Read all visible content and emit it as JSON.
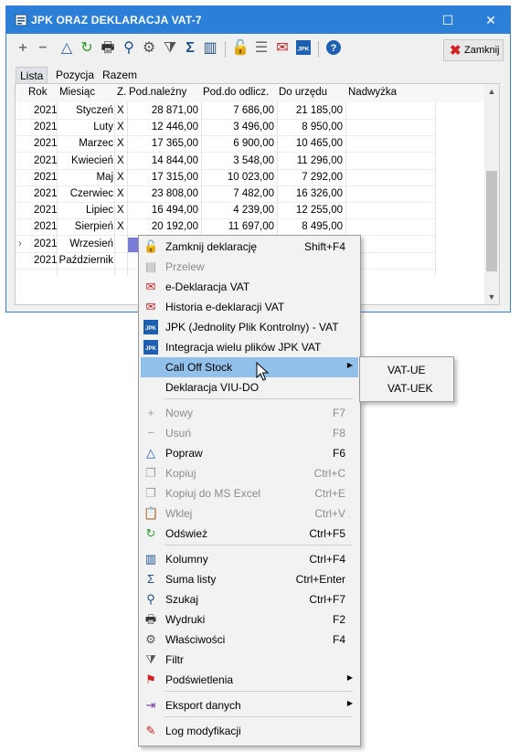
{
  "window": {
    "title": "JPK ORAZ DEKLARACJA VAT-7",
    "close_label": "Zamknij"
  },
  "tabs": [
    "Lista",
    "Pozycja",
    "Razem"
  ],
  "columns": [
    "Rok",
    "Miesiąc",
    "Z.",
    "Pod.należny",
    "Pod.do odlicz.",
    "Do urzędu",
    "Nadwyżka"
  ],
  "rows": [
    {
      "rok": "2021",
      "miesiac": "Styczeń",
      "z": "X",
      "nalezny": "28 871,00",
      "odlicz": "7 686,00",
      "urzad": "21 185,00"
    },
    {
      "rok": "2021",
      "miesiac": "Luty",
      "z": "X",
      "nalezny": "12 446,00",
      "odlicz": "3 496,00",
      "urzad": "8 950,00"
    },
    {
      "rok": "2021",
      "miesiac": "Marzec",
      "z": "X",
      "nalezny": "17 365,00",
      "odlicz": "6 900,00",
      "urzad": "10 465,00"
    },
    {
      "rok": "2021",
      "miesiac": "Kwiecień",
      "z": "X",
      "nalezny": "14 844,00",
      "odlicz": "3 548,00",
      "urzad": "11 296,00"
    },
    {
      "rok": "2021",
      "miesiac": "Maj",
      "z": "X",
      "nalezny": "17 315,00",
      "odlicz": "10 023,00",
      "urzad": "7 292,00"
    },
    {
      "rok": "2021",
      "miesiac": "Czerwiec",
      "z": "X",
      "nalezny": "23 808,00",
      "odlicz": "7 482,00",
      "urzad": "16 326,00"
    },
    {
      "rok": "2021",
      "miesiac": "Lipiec",
      "z": "X",
      "nalezny": "16 494,00",
      "odlicz": "4 239,00",
      "urzad": "12 255,00"
    },
    {
      "rok": "2021",
      "miesiac": "Sierpień",
      "z": "X",
      "nalezny": "20 192,00",
      "odlicz": "11 697,00",
      "urzad": "8 495,00"
    },
    {
      "rok": "2021",
      "miesiac": "Wrzesień",
      "z": "",
      "nalezny": "",
      "odlicz": "",
      "urzad": ""
    },
    {
      "rok": "2021",
      "miesiac": "Październik",
      "z": "",
      "nalezny": "",
      "odlicz": "",
      "urzad": ""
    }
  ],
  "menu": [
    {
      "label": "Zamknij deklarację",
      "shortcut": "Shift+F4",
      "icon": "lock-icon",
      "disabled": false
    },
    {
      "label": "Przelew",
      "shortcut": "",
      "icon": "transfer-icon",
      "disabled": true
    },
    {
      "label": "e-Deklaracja VAT",
      "shortcut": "",
      "icon": "edeclaration-icon",
      "disabled": false
    },
    {
      "label": "Historia e-deklaracji VAT",
      "shortcut": "",
      "icon": "history-icon",
      "disabled": false
    },
    {
      "label": "JPK (Jednolity Plik Kontrolny) - VAT",
      "shortcut": "",
      "icon": "jpk-icon",
      "disabled": false
    },
    {
      "label": "Integracja wielu plików JPK VAT",
      "shortcut": "",
      "icon": "jpk-integration-icon",
      "disabled": false
    },
    {
      "label": "Call Off Stock",
      "shortcut": "",
      "icon": "",
      "disabled": false
    },
    {
      "label": "Deklaracja VIU-DO",
      "shortcut": "",
      "icon": "",
      "disabled": false
    },
    {
      "label": "Nowy",
      "shortcut": "F7",
      "icon": "plus-icon",
      "disabled": true
    },
    {
      "label": "Usuń",
      "shortcut": "F8",
      "icon": "minus-icon",
      "disabled": true
    },
    {
      "label": "Popraw",
      "shortcut": "F6",
      "icon": "edit-triangle-icon",
      "disabled": false
    },
    {
      "label": "Kopiuj",
      "shortcut": "Ctrl+C",
      "icon": "copy-icon",
      "disabled": true
    },
    {
      "label": "Kopiuj do MS Excel",
      "shortcut": "Ctrl+E",
      "icon": "copy-excel-icon",
      "disabled": true
    },
    {
      "label": "Wklej",
      "shortcut": "Ctrl+V",
      "icon": "paste-icon",
      "disabled": true
    },
    {
      "label": "Odśwież",
      "shortcut": "Ctrl+F5",
      "icon": "refresh-icon",
      "disabled": false
    },
    {
      "label": "Kolumny",
      "shortcut": "Ctrl+F4",
      "icon": "columns-icon",
      "disabled": false
    },
    {
      "label": "Suma listy",
      "shortcut": "Ctrl+Enter",
      "icon": "sigma-icon",
      "disabled": false
    },
    {
      "label": "Szukaj",
      "shortcut": "Ctrl+F7",
      "icon": "search-icon",
      "disabled": false
    },
    {
      "label": "Wydruki",
      "shortcut": "F2",
      "icon": "printer-icon",
      "disabled": false
    },
    {
      "label": "Właściwości",
      "shortcut": "F4",
      "icon": "gears-icon",
      "disabled": false
    },
    {
      "label": "Filtr",
      "shortcut": "",
      "icon": "filter-icon",
      "disabled": false
    },
    {
      "label": "Podświetlenia",
      "shortcut": "",
      "icon": "flag-icon",
      "disabled": false
    },
    {
      "label": "Eksport danych",
      "shortcut": "",
      "icon": "export-icon",
      "disabled": false
    },
    {
      "label": "Log modyfikacji",
      "shortcut": "",
      "icon": "log-icon",
      "disabled": false
    }
  ],
  "submenu": [
    "VAT-UE",
    "VAT-UEK"
  ],
  "toolbar_icons": [
    "plus-icon",
    "minus-icon",
    "edit-triangle-icon",
    "refresh-icon",
    "printer-icon",
    "search-icon",
    "gears-icon",
    "filter-icon",
    "sigma-icon",
    "columns-icon",
    "lock-icon",
    "list-icon",
    "edeclaration-icon",
    "jpk-icon",
    "help-icon"
  ],
  "colors": {
    "titlebar": "#2c7fd6",
    "menu_highlight": "#91c0ea",
    "selection": "#7b7bd8"
  }
}
